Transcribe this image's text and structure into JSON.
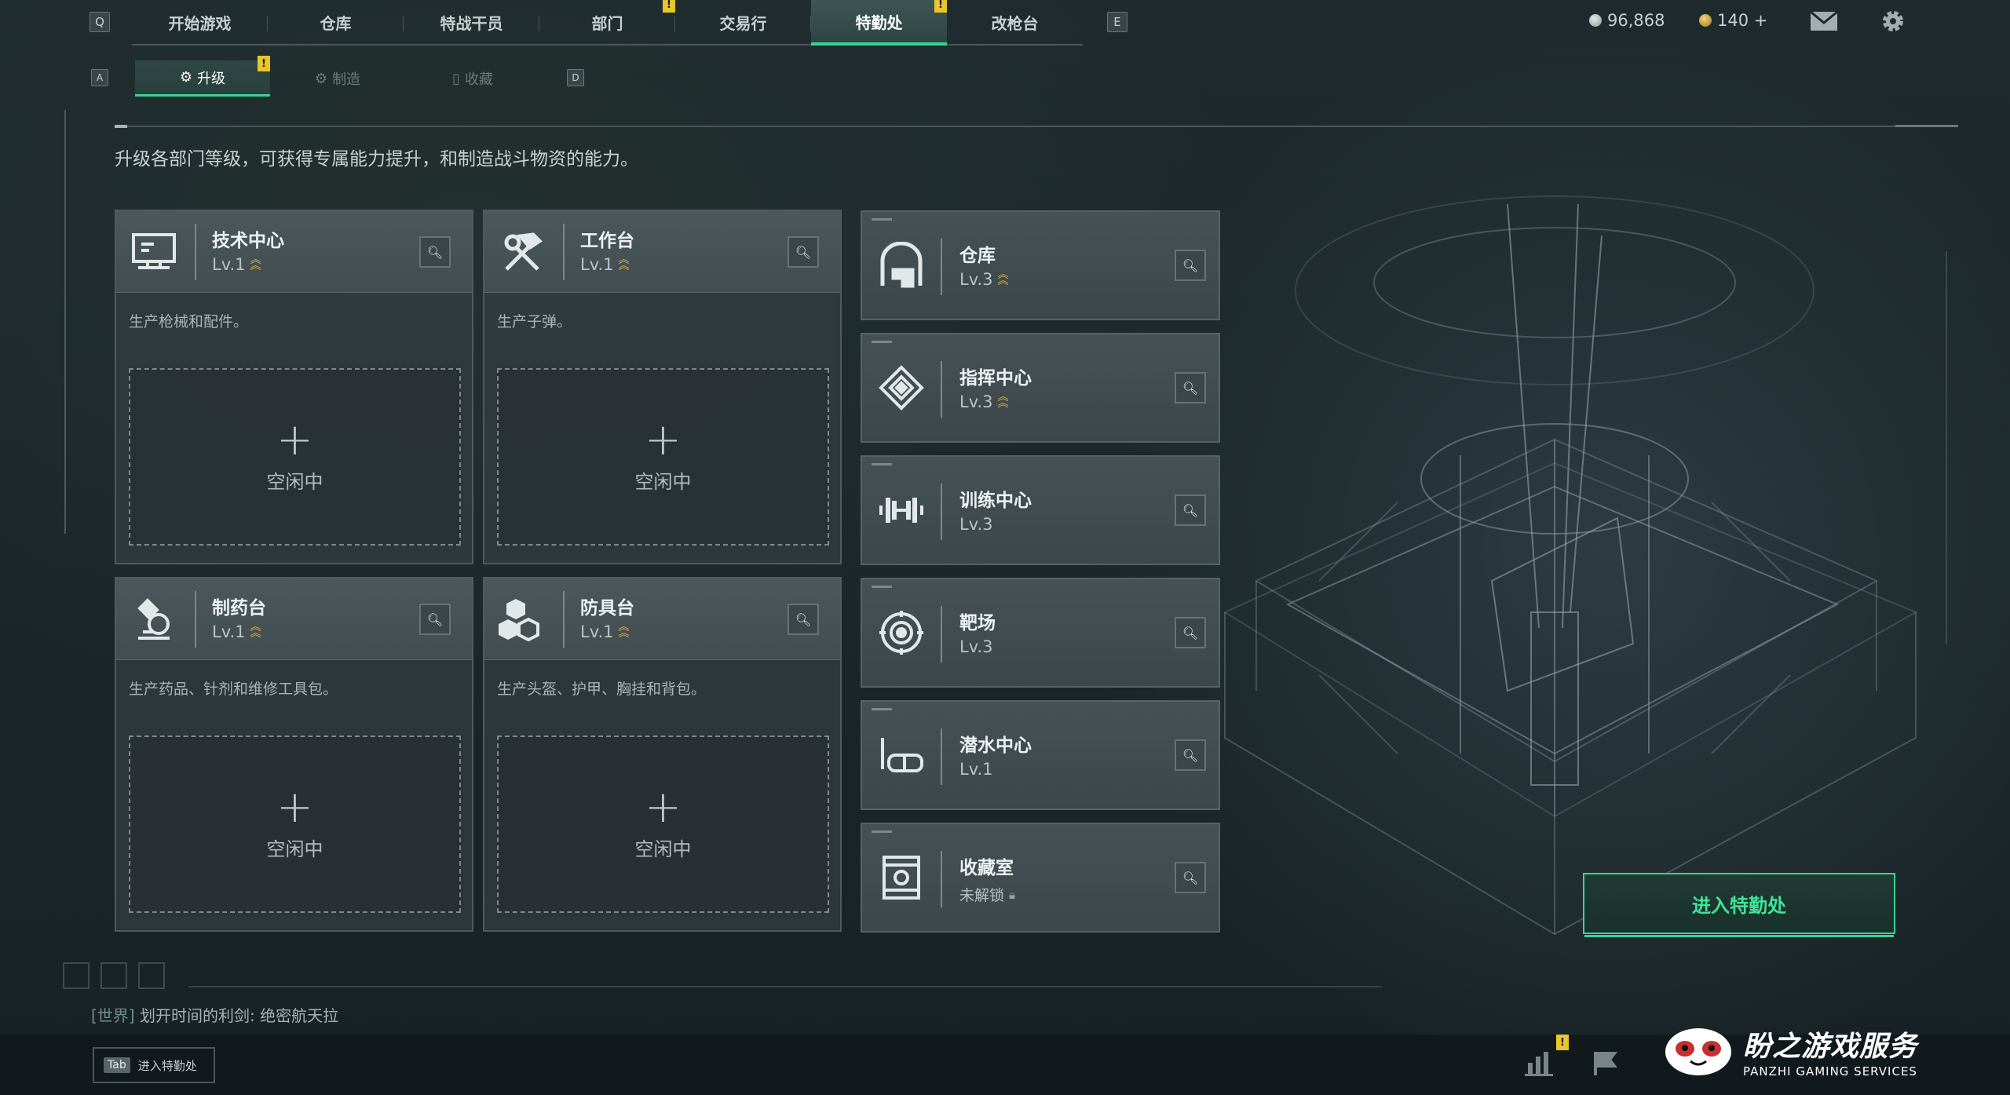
{
  "nav": {
    "key_left": "Q",
    "key_right": "E",
    "tabs": [
      {
        "label": "开始游戏",
        "badge": ""
      },
      {
        "label": "仓库",
        "badge": ""
      },
      {
        "label": "特战干员",
        "badge": ""
      },
      {
        "label": "部门",
        "badge": "!"
      },
      {
        "label": "交易行",
        "badge": ""
      },
      {
        "label": "特勤处",
        "badge": "!"
      },
      {
        "label": "改枪台",
        "badge": ""
      }
    ],
    "active_tab": "特勤处"
  },
  "currency": {
    "silver": "96,868",
    "gold": "140 +"
  },
  "subnav": {
    "key_left": "A",
    "key_right": "D",
    "tabs": [
      {
        "label": "升级",
        "badge": "!"
      },
      {
        "label": "制造",
        "badge": ""
      },
      {
        "label": "收藏",
        "badge": ""
      }
    ],
    "active_tab": "升级"
  },
  "description": "升级各部门等级，可获得专属能力提升，和制造战斗物资的能力。",
  "production_cards": [
    {
      "title": "技术中心",
      "level": "Lv.1",
      "desc": "生产枪械和配件。",
      "slot": "空闲中",
      "icon": "computer-icon"
    },
    {
      "title": "工作台",
      "level": "Lv.1",
      "desc": "生产子弹。",
      "slot": "空闲中",
      "icon": "hammer-wrench-icon"
    },
    {
      "title": "制药台",
      "level": "Lv.1",
      "desc": "生产药品、针剂和维修工具包。",
      "slot": "空闲中",
      "icon": "microscope-icon"
    },
    {
      "title": "防具台",
      "level": "Lv.1",
      "desc": "生产头盔、护甲、胸挂和背包。",
      "slot": "空闲中",
      "icon": "cubes-icon"
    }
  ],
  "facility_cards": [
    {
      "title": "仓库",
      "level": "Lv.3",
      "upgradable": true,
      "icon": "warehouse-icon"
    },
    {
      "title": "指挥中心",
      "level": "Lv.3",
      "upgradable": true,
      "icon": "diamond-pattern-icon"
    },
    {
      "title": "训练中心",
      "level": "Lv.3",
      "upgradable": false,
      "icon": "dumbbell-icon"
    },
    {
      "title": "靶场",
      "level": "Lv.3",
      "upgradable": false,
      "icon": "target-icon"
    },
    {
      "title": "潜水中心",
      "level": "Lv.1",
      "upgradable": false,
      "icon": "diving-mask-icon"
    },
    {
      "title": "收藏室",
      "level": "未解锁",
      "upgradable": false,
      "locked": true,
      "icon": "display-case-icon"
    }
  ],
  "enter_button": "进入特勤处",
  "chat": {
    "channel": "[世界]",
    "message": "划开时间的利剑: 绝密航天拉"
  },
  "tab_hint": {
    "key": "Tab",
    "label": "进入特勤处"
  },
  "logo": {
    "title": "盼之游戏服务",
    "subtitle": "PANZHI GAMING SERVICES"
  },
  "colors": {
    "accent": "#3ad492",
    "badge": "#e9c62a",
    "upgrade_chevron": "#e0b43a"
  }
}
